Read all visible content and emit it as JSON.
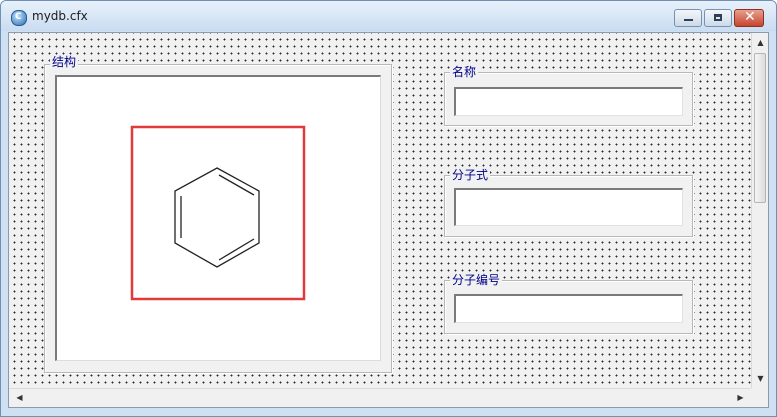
{
  "window": {
    "title": "mydb.cfx"
  },
  "structure_group": {
    "label": "结构"
  },
  "fields": [
    {
      "label": "名称",
      "value": ""
    },
    {
      "label": "分子式",
      "value": ""
    },
    {
      "label": "分子编号",
      "value": ""
    }
  ],
  "colors": {
    "selection_frame": "#e03a3a",
    "group_label": "#000088"
  }
}
